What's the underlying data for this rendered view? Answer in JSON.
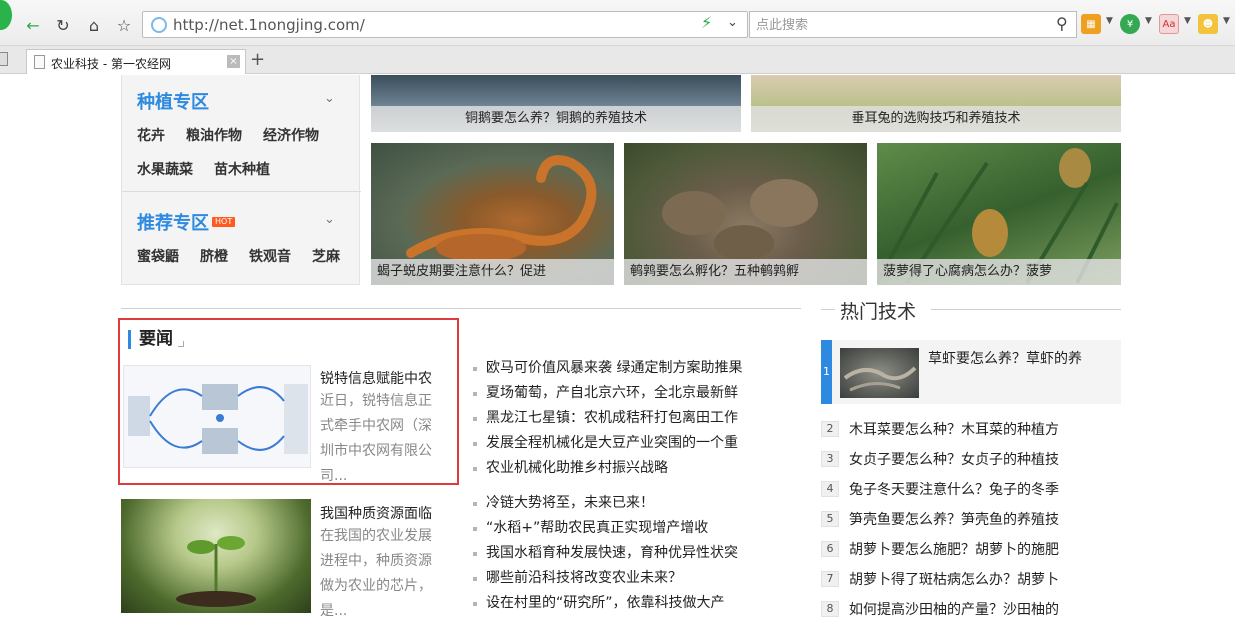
{
  "browser": {
    "url": "http://net.1nongjing.com/",
    "search_placeholder": "点此搜索",
    "tab_title": "农业科技 - 第一农经网",
    "tab_close": "×",
    "new_tab": "+",
    "ext_font_label": "Aa"
  },
  "sidebar": {
    "section1": {
      "title": "种植专区",
      "items": [
        "花卉",
        "粮油作物",
        "经济作物",
        "水果蔬菜",
        "苗木种植"
      ]
    },
    "section2": {
      "title": "推荐专区",
      "badge": "HOT",
      "items": [
        "蜜袋鼯",
        "脐橙",
        "铁观音",
        "芝麻"
      ]
    }
  },
  "top_thumbs": [
    {
      "caption": "铜鹅要怎么养？铜鹅的养殖技术"
    },
    {
      "caption": "垂耳兔的选购技巧和养殖技术"
    }
  ],
  "mid_thumbs": [
    {
      "caption": "蝎子蜕皮期要注意什么？促进"
    },
    {
      "caption": "鹌鹑要怎么孵化？五种鹌鹑孵"
    },
    {
      "caption": "菠萝得了心腐病怎么办？菠萝"
    }
  ],
  "news": {
    "heading": "要闻",
    "feature1": {
      "title": "锐特信息赋能中农",
      "desc": "近日，锐特信息正式牵手中农网（深圳市中农网有限公司..."
    },
    "feature2": {
      "title": "我国种质资源面临",
      "desc": "在我国的农业发展进程中，种质资源做为农业的芯片，是..."
    },
    "list1": [
      "欧马可价值风暴来袭 绿通定制方案助推果",
      "夏场葡萄，产自北京六环，全北京最新鲜",
      "黑龙江七星镇：农机成秸秆打包离田工作",
      "发展全程机械化是大豆产业突围的一个重",
      "农业机械化助推乡村振兴战略"
    ],
    "list2": [
      "冷链大势将至，未来已来！",
      "“水稻+”帮助农民真正实现增产增收",
      "我国水稻育种发展快速，育种优异性状突",
      "哪些前沿科技将改变农业未来？",
      "设在村里的“研究所”，依靠科技做大产"
    ]
  },
  "hot": {
    "heading": "热门技术",
    "first": {
      "rank": "1",
      "title": "草虾要怎么养？草虾的养"
    },
    "items": [
      {
        "rank": "2",
        "title": "木耳菜要怎么种？木耳菜的种植方"
      },
      {
        "rank": "3",
        "title": "女贞子要怎么种？女贞子的种植技"
      },
      {
        "rank": "4",
        "title": "兔子冬天要注意什么？兔子的冬季"
      },
      {
        "rank": "5",
        "title": "笋壳鱼要怎么养？笋壳鱼的养殖技"
      },
      {
        "rank": "6",
        "title": "胡萝卜要怎么施肥？胡萝卜的施肥"
      },
      {
        "rank": "7",
        "title": "胡萝卜得了斑枯病怎么办？胡萝卜"
      },
      {
        "rank": "8",
        "title": "如何提高沙田柚的产量？沙田柚的"
      }
    ]
  },
  "colors": {
    "accent": "#2d8ae0",
    "highlight": "#e03a3a",
    "hot_badge": "#ff5a1f"
  }
}
